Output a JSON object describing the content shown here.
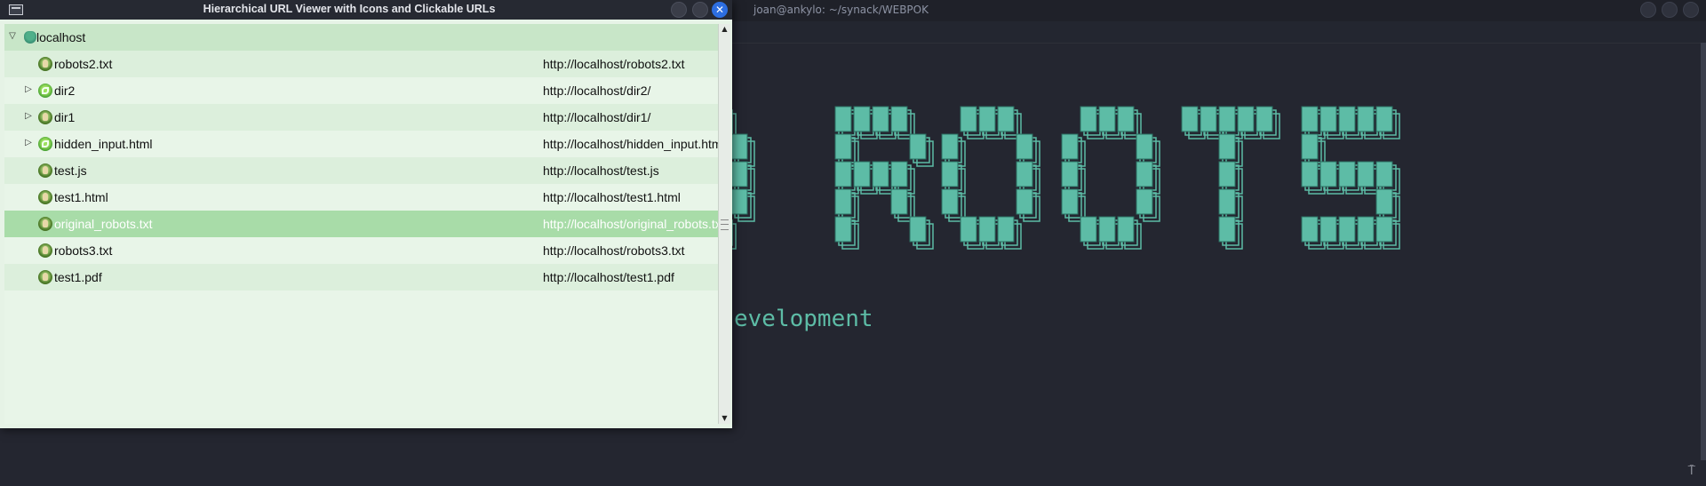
{
  "terminal": {
    "title": "joan@ankylo: ~/synack/WEBPOK",
    "visible_text": "evelopment",
    "corner_glyph": "⍑",
    "accent_color": "#5dbca6"
  },
  "window": {
    "title": "Hierarchical URL Viewer with Icons and Clickable URLs",
    "controls": {
      "close_glyph": "✕"
    },
    "tree": {
      "root": {
        "name": "localhost",
        "expanded": true
      },
      "rows": [
        {
          "name": "robots2.txt",
          "url": "http://localhost/robots2.txt",
          "expandable": false,
          "icon": "file-icon",
          "selected": false
        },
        {
          "name": "dir2",
          "url": "http://localhost/dir2/",
          "expandable": true,
          "icon": "directory-icon",
          "selected": false
        },
        {
          "name": "dir1",
          "url": "http://localhost/dir1/",
          "expandable": true,
          "icon": "file-icon",
          "selected": false
        },
        {
          "name": "hidden_input.html",
          "url": "http://localhost/hidden_input.html",
          "expandable": true,
          "icon": "directory-icon",
          "selected": false
        },
        {
          "name": "test.js",
          "url": "http://localhost/test.js",
          "expandable": false,
          "icon": "file-icon",
          "selected": false
        },
        {
          "name": "test1.html",
          "url": "http://localhost/test1.html",
          "expandable": false,
          "icon": "file-icon",
          "selected": false
        },
        {
          "name": "original_robots.txt",
          "url": "http://localhost/original_robots.txt",
          "expandable": false,
          "icon": "file-icon",
          "selected": true
        },
        {
          "name": "robots3.txt",
          "url": "http://localhost/robots3.txt",
          "expandable": false,
          "icon": "file-icon",
          "selected": false
        },
        {
          "name": "test1.pdf",
          "url": "http://localhost/test1.pdf",
          "expandable": false,
          "icon": "file-icon",
          "selected": false
        }
      ]
    }
  }
}
